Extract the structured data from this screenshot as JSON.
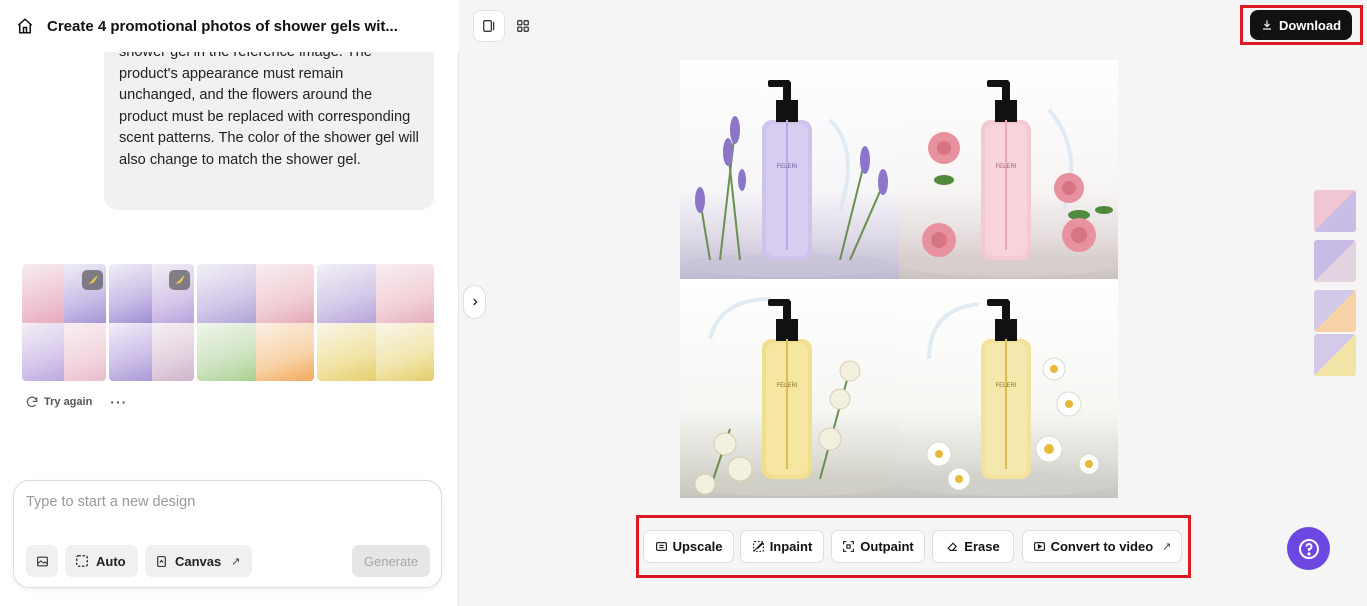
{
  "header": {
    "title": "Create 4 promotional photos of shower gels wit..."
  },
  "chat": {
    "message": "shower gel in the reference image. The product's appearance must remain unchanged, and the flowers around the product must be replaced with corresponding scent patterns. The color of the shower gel will also change to match the shower gel."
  },
  "results": {
    "try_again_label": "Try again",
    "more_label": "···"
  },
  "composer": {
    "placeholder": "Type to start a new design",
    "auto_label": "Auto",
    "canvas_label": "Canvas",
    "canvas_arrow": "↗",
    "generate_label": "Generate"
  },
  "toolbar": {
    "download_label": "Download"
  },
  "tools": [
    {
      "label": "Upscale"
    },
    {
      "label": "Inpaint"
    },
    {
      "label": "Outpaint"
    },
    {
      "label": "Erase"
    },
    {
      "label": "Convert to video",
      "arrow": "↗"
    }
  ],
  "product_brand": "FELERI",
  "colors": {
    "highlight": "#d91a21",
    "help": "#6c47e0",
    "primary_button": "#111111"
  }
}
